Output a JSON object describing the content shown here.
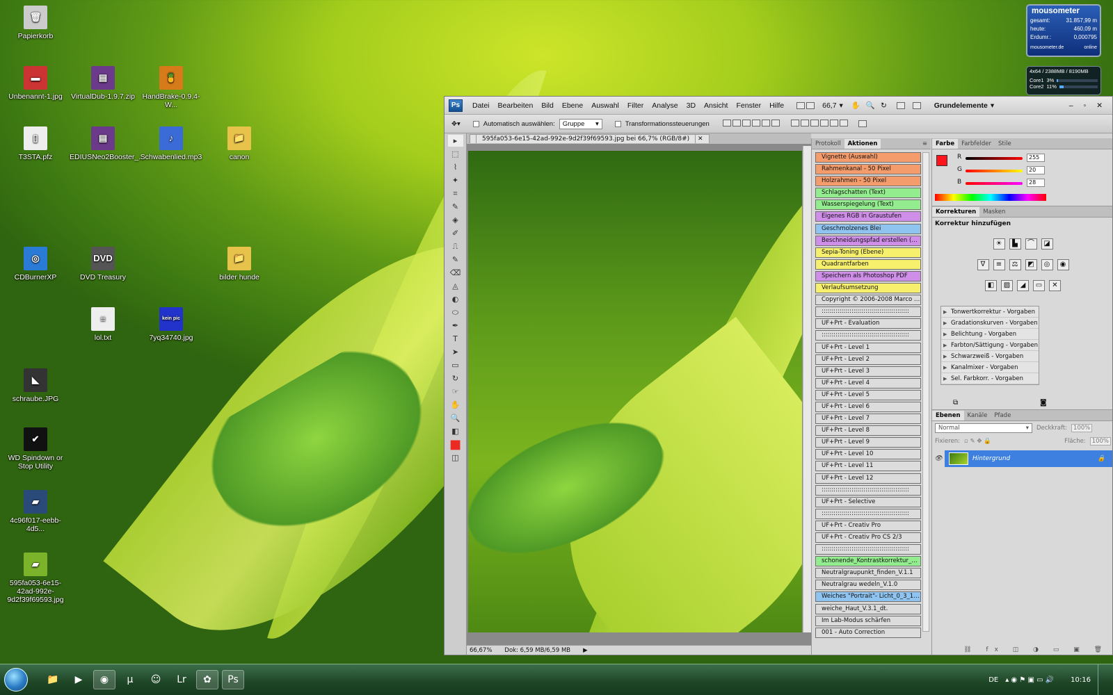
{
  "desktop": {
    "icons": [
      {
        "label": "Papierkorb",
        "glyph": "🗑"
      },
      {
        "label": "Unbenannt-1.jpg",
        "glyph": "▬"
      },
      {
        "label": "VirtualDub-1.9.7.zip",
        "glyph": "▤"
      },
      {
        "label": "HandBrake-0.9.4-W...",
        "glyph": "🍍"
      },
      {
        "label": "T3STA.pfz",
        "glyph": "▯"
      },
      {
        "label": "EDIUSNeo2Booster_...",
        "glyph": "▤"
      },
      {
        "label": "Schwabenlied.mp3",
        "glyph": "♪"
      },
      {
        "label": "canon",
        "glyph": "📁"
      },
      {
        "label": "CDBurnerXP",
        "glyph": "◎"
      },
      {
        "label": "DVD Treasury",
        "glyph": "DVD"
      },
      {
        "label": "bilder hunde",
        "glyph": "📁"
      },
      {
        "label": "lol.txt",
        "glyph": "≡"
      },
      {
        "label": "7yq34740.jpg",
        "glyph": "kein pic"
      },
      {
        "label": "schraube.JPG",
        "glyph": "◣"
      },
      {
        "label": "WD Spindown or Stop Utility",
        "glyph": "✔"
      },
      {
        "label": "4c96f017-eebb-4d5...",
        "glyph": "▰"
      },
      {
        "label": "595fa053-6e15-42ad-992e-9d2f39f69593.jpg",
        "glyph": "▰"
      }
    ]
  },
  "mousometer": {
    "title": "mousometer",
    "rows": [
      {
        "k": "gesamt:",
        "v": "31.857,99 m"
      },
      {
        "k": "heute:",
        "v": "460,09 m"
      },
      {
        "k": "Erdumr.:",
        "v": "0,000795"
      }
    ],
    "footer": "mousometer.de",
    "status": "online"
  },
  "cpu": {
    "header": "4x64 / 2388MB / 8190MB",
    "cores": [
      {
        "name": "Core1",
        "pct": "3%",
        "fill": 0.03
      },
      {
        "name": "Core2",
        "pct": "11%",
        "fill": 0.11
      }
    ]
  },
  "ps": {
    "logo": "Ps",
    "menu": [
      "Datei",
      "Bearbeiten",
      "Bild",
      "Ebene",
      "Auswahl",
      "Filter",
      "Analyse",
      "3D",
      "Ansicht",
      "Fenster",
      "Hilfe"
    ],
    "zoom_select": "66,7",
    "workspace": "Grundelemente",
    "options": {
      "auto_select": "Automatisch auswählen:",
      "group": "Gruppe",
      "transform": "Transformationssteuerungen"
    },
    "doc_tab": "595fa053-6e15-42ad-992e-9d2f39f69593.jpg bei 66,7% (RGB/8#)",
    "status_zoom": "66,67%",
    "status_doc": "Dok: 6,59 MB/6,59 MB",
    "panel_tabs": {
      "history": "Protokoll",
      "actions": "Aktionen"
    },
    "actions": [
      {
        "label": "Vignette (Auswahl)",
        "color": "#f59c6c"
      },
      {
        "label": "Rahmenkanal - 50 Pixel",
        "color": "#f59c6c"
      },
      {
        "label": "Holzrahmen - 50 Pixel",
        "color": "#f59c6c"
      },
      {
        "label": "Schlagschatten (Text)",
        "color": "#93ec8e"
      },
      {
        "label": "Wasserspiegelung (Text)",
        "color": "#93ec8e"
      },
      {
        "label": "Eigenes RGB in Graustufen",
        "color": "#cf8ee8"
      },
      {
        "label": "Geschmolzenes Blei",
        "color": "#8fc3f0"
      },
      {
        "label": "Beschneidungspfad erstellen (Au...",
        "color": "#cf8ee8"
      },
      {
        "label": "Sepia-Toning (Ebene)",
        "color": "#f6f06c"
      },
      {
        "label": "Quadrantfarben",
        "color": "#f6f06c"
      },
      {
        "label": "Speichern als Photoshop PDF",
        "color": "#cf8ee8"
      },
      {
        "label": "Verlaufsumsetzung",
        "color": "#f6f06c"
      },
      {
        "label": "Copyright © 2006-2008 Marco Rutz",
        "color": "#dcdcdc"
      },
      {
        "label": "::::::::::::::::::::::::::::::::::::::::::::",
        "color": "#dcdcdc"
      },
      {
        "label": "UF+Prt - Evaluation",
        "color": "#dcdcdc"
      },
      {
        "label": "::::::::::::::::::::::::::::::::::::::::::::",
        "color": "#dcdcdc"
      },
      {
        "label": "UF+Prt - Level 1",
        "color": "#dcdcdc"
      },
      {
        "label": "UF+Prt - Level 2",
        "color": "#dcdcdc"
      },
      {
        "label": "UF+Prt - Level 3",
        "color": "#dcdcdc"
      },
      {
        "label": "UF+Prt - Level 4",
        "color": "#dcdcdc"
      },
      {
        "label": "UF+Prt - Level 5",
        "color": "#dcdcdc"
      },
      {
        "label": "UF+Prt - Level 6",
        "color": "#dcdcdc"
      },
      {
        "label": "UF+Prt - Level 7",
        "color": "#dcdcdc"
      },
      {
        "label": "UF+Prt - Level 8",
        "color": "#dcdcdc"
      },
      {
        "label": "UF+Prt - Level 9",
        "color": "#dcdcdc"
      },
      {
        "label": "UF+Prt - Level 10",
        "color": "#dcdcdc"
      },
      {
        "label": "UF+Prt - Level 11",
        "color": "#dcdcdc"
      },
      {
        "label": "UF+Prt - Level 12",
        "color": "#dcdcdc"
      },
      {
        "label": "::::::::::::::::::::::::::::::::::::::::::::",
        "color": "#dcdcdc"
      },
      {
        "label": "UF+Prt - Selective",
        "color": "#dcdcdc"
      },
      {
        "label": "::::::::::::::::::::::::::::::::::::::::::::",
        "color": "#dcdcdc"
      },
      {
        "label": "UF+Prt - Creativ Pro",
        "color": "#dcdcdc"
      },
      {
        "label": "UF+Prt - Creativ Pro CS 2/3",
        "color": "#dcdcdc"
      },
      {
        "label": "::::::::::::::::::::::::::::::::::::::::::::",
        "color": "#dcdcdc"
      },
      {
        "label": "schonende_Kontrastkorrektur_V....",
        "color": "#93ec8e"
      },
      {
        "label": "Neutralgraupunkt_finden_V.1.1",
        "color": "#dcdcdc"
      },
      {
        "label": "Neutralgrau wedeln_V.1.0",
        "color": "#dcdcdc"
      },
      {
        "label": "Weiches \"Portrait\"- Licht_0_3_10_...",
        "color": "#8fc3f0"
      },
      {
        "label": "weiche_Haut_V.3.1_dt.",
        "color": "#dcdcdc"
      },
      {
        "label": "Im Lab-Modus schärfen",
        "color": "#dcdcdc"
      },
      {
        "label": "001 - Auto Correction",
        "color": "#dcdcdc"
      }
    ],
    "color_panel": {
      "tabs": [
        "Farbe",
        "Farbfelder",
        "Stile"
      ],
      "r_label": "R",
      "g_label": "G",
      "b_label": "B",
      "r": "255",
      "g": "20",
      "b": "28",
      "fg": "#ff141c"
    },
    "adjust_panel": {
      "tabs": [
        "Korrekturen",
        "Masken"
      ],
      "title": "Korrektur hinzufügen",
      "presets": [
        "Tonwertkorrektur - Vorgaben",
        "Gradationskurven - Vorgaben",
        "Belichtung - Vorgaben",
        "Farbton/Sättigung - Vorgaben",
        "Schwarzweiß - Vorgaben",
        "Kanalmixer - Vorgaben",
        "Sel. Farbkorr. - Vorgaben"
      ]
    },
    "layers_panel": {
      "tabs": [
        "Ebenen",
        "Kanäle",
        "Pfade"
      ],
      "blend": "Normal",
      "opacity_label": "Deckkraft:",
      "opacity": "100%",
      "lock_label": "Fixieren:",
      "fill_label": "Fläche:",
      "fill": "100%",
      "layer": "Hintergrund"
    }
  },
  "taskbar": {
    "lang": "DE",
    "time": "10:16"
  }
}
